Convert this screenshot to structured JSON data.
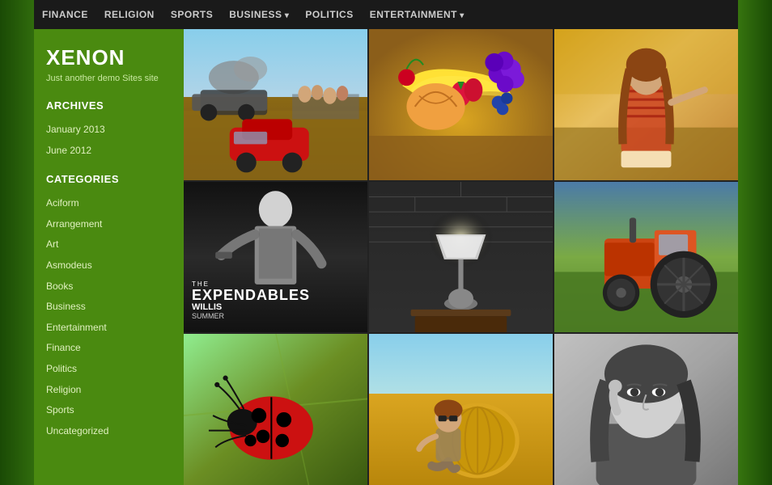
{
  "background": {
    "color": "#4a8a10"
  },
  "nav": {
    "items": [
      {
        "label": "FINANCE",
        "has_arrow": false
      },
      {
        "label": "RELIGION",
        "has_arrow": false
      },
      {
        "label": "SPORTS",
        "has_arrow": false
      },
      {
        "label": "BUSINESS",
        "has_arrow": true
      },
      {
        "label": "POLITICS",
        "has_arrow": false
      },
      {
        "label": "ENTERTAINMENT",
        "has_arrow": true
      }
    ]
  },
  "sidebar": {
    "site_title": "XENON",
    "site_subtitle": "Just another demo Sites site",
    "archives_label": "ARCHIVES",
    "archives": [
      {
        "label": "January 2013"
      },
      {
        "label": "June 2012"
      }
    ],
    "categories_label": "CATEGORIES",
    "categories": [
      {
        "label": "Aciform"
      },
      {
        "label": "Arrangement"
      },
      {
        "label": "Art"
      },
      {
        "label": "Asmodeus"
      },
      {
        "label": "Books"
      },
      {
        "label": "Business"
      },
      {
        "label": "Entertainment"
      },
      {
        "label": "Finance"
      },
      {
        "label": "Politics"
      },
      {
        "label": "Religion"
      },
      {
        "label": "Sports"
      },
      {
        "label": "Uncategorized"
      }
    ]
  },
  "grid": {
    "cells": [
      {
        "id": "cars",
        "type": "cars-scene",
        "alt": "Vintage racing cars scene"
      },
      {
        "id": "fruits",
        "type": "fruits-scene",
        "alt": "Colorful fruits bowl"
      },
      {
        "id": "girl",
        "type": "girl-scene",
        "alt": "Girl outdoors portrait"
      },
      {
        "id": "expendables",
        "type": "expendables-scene",
        "alt": "The Expendables movie poster"
      },
      {
        "id": "lamp",
        "type": "lamp-scene",
        "alt": "Lamp in dark room"
      },
      {
        "id": "tractor",
        "type": "tractor-scene",
        "alt": "Old red tractor"
      },
      {
        "id": "beetle",
        "type": "beetle-scene",
        "alt": "Red beetle on leaf"
      },
      {
        "id": "hayfield",
        "type": "hayfield-scene",
        "alt": "Man in hayfield"
      },
      {
        "id": "woman-bw",
        "type": "woman-bw-scene",
        "alt": "Woman black and white portrait"
      }
    ],
    "expendables_text": {
      "the": "THE",
      "title": "EXPENDABLES",
      "willis": "WILLIS",
      "summer": "SUMMER"
    }
  }
}
